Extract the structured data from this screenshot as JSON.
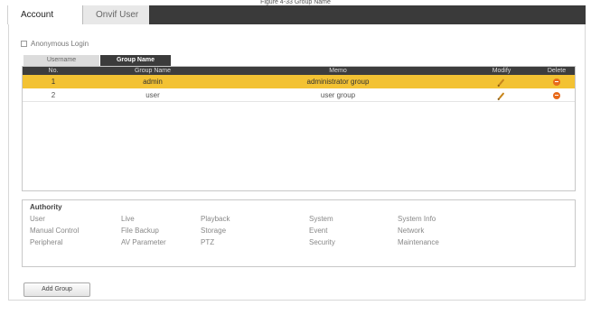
{
  "caption": "Figure 4-33 Group Name",
  "tabs": [
    {
      "label": "Account",
      "active": true
    },
    {
      "label": "Onvif User",
      "active": false
    }
  ],
  "anonymous_login": {
    "label": "Anonymous Login",
    "checked": false
  },
  "subtabs": [
    {
      "label": "Username",
      "active": false
    },
    {
      "label": "Group Name",
      "active": true
    }
  ],
  "table": {
    "columns": [
      "No.",
      "Group Name",
      "Memo",
      "Modify",
      "Delete"
    ],
    "rows": [
      {
        "no": "1",
        "group_name": "admin",
        "memo": "administrator group",
        "selected": true
      },
      {
        "no": "2",
        "group_name": "user",
        "memo": "user group",
        "selected": false
      }
    ]
  },
  "authority": {
    "title": "Authority",
    "rows": [
      [
        "User",
        "Live",
        "Playback",
        "System",
        "System Info"
      ],
      [
        "Manual Control",
        "File Backup",
        "Storage",
        "Event",
        "Network"
      ],
      [
        "Peripheral",
        "AV Parameter",
        "PTZ",
        "Security",
        "Maintenance"
      ]
    ]
  },
  "add_group_button": "Add Group",
  "colors": {
    "header_bar": "#3a3a3a",
    "selected_row": "#f3c233",
    "delete_icon": "#e86a1a",
    "modify_icon": "#c8861c"
  },
  "icons": {
    "modify": "pencil-icon",
    "delete": "delete-circle-icon"
  }
}
